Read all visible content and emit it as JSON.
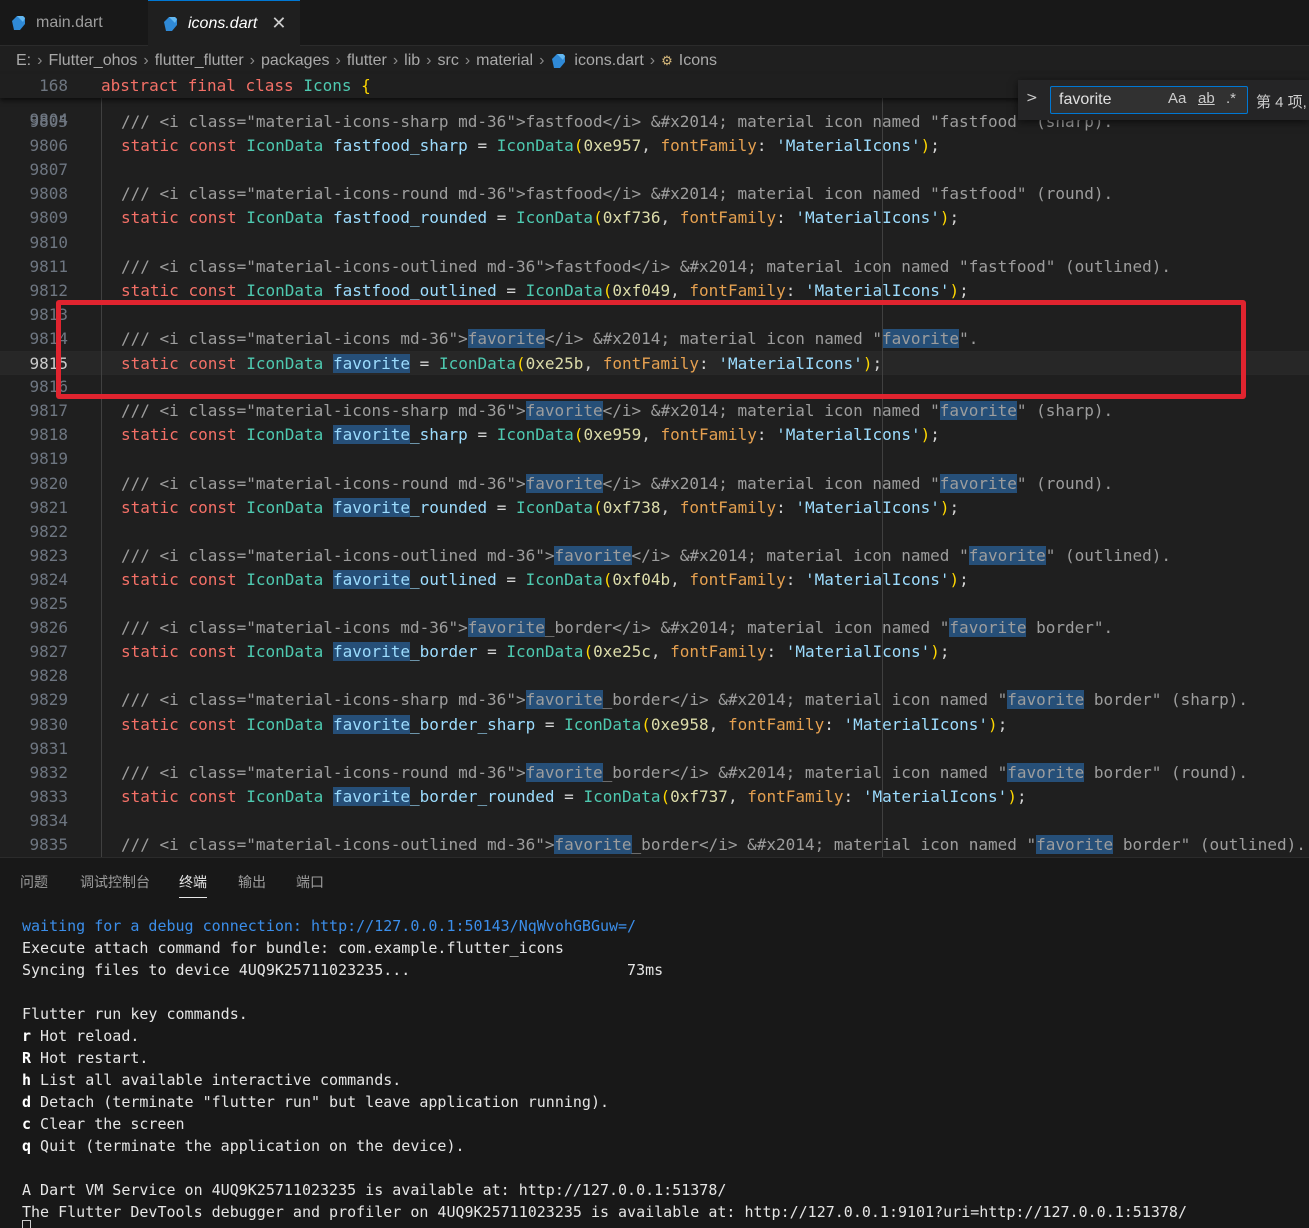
{
  "tabs": [
    {
      "label": "main.dart",
      "active": false
    },
    {
      "label": "icons.dart",
      "active": true,
      "close": "✕"
    }
  ],
  "breadcrumb": [
    "E:",
    "Flutter_ohos",
    "flutter_flutter",
    "packages",
    "flutter",
    "lib",
    "src",
    "material",
    "icons.dart",
    "Icons"
  ],
  "sticky": {
    "line": "168",
    "code": [
      "abstract final class Icons {"
    ]
  },
  "find": {
    "value": "favorite",
    "toggle": ">",
    "match_case": "Aa",
    "whole_word": "ab",
    "regex": ".*",
    "count": "第 4 项,"
  },
  "editor": {
    "partial_line_number": "9804",
    "current_line": "9815",
    "lines": [
      {
        "n": "9805",
        "text": "/// <i class=\"material-icons-sharp md-36\">fastfood</i> &#x2014; material icon named \"fastfood\" (sharp)."
      },
      {
        "n": "9806",
        "text": "static const IconData fastfood_sharp = IconData(0xe957, fontFamily: 'MaterialIcons');"
      },
      {
        "n": "9807",
        "text": ""
      },
      {
        "n": "9808",
        "text": "/// <i class=\"material-icons-round md-36\">fastfood</i> &#x2014; material icon named \"fastfood\" (round)."
      },
      {
        "n": "9809",
        "text": "static const IconData fastfood_rounded = IconData(0xf736, fontFamily: 'MaterialIcons');"
      },
      {
        "n": "9810",
        "text": ""
      },
      {
        "n": "9811",
        "text": "/// <i class=\"material-icons-outlined md-36\">fastfood</i> &#x2014; material icon named \"fastfood\" (outlined)."
      },
      {
        "n": "9812",
        "text": "static const IconData fastfood_outlined = IconData(0xf049, fontFamily: 'MaterialIcons');"
      },
      {
        "n": "9813",
        "text": ""
      },
      {
        "n": "9814",
        "text": "/// <i class=\"material-icons md-36\">favorite</i> &#x2014; material icon named \"favorite\"."
      },
      {
        "n": "9815",
        "text": "static const IconData favorite = IconData(0xe25b, fontFamily: 'MaterialIcons');"
      },
      {
        "n": "9816",
        "text": ""
      },
      {
        "n": "9817",
        "text": "/// <i class=\"material-icons-sharp md-36\">favorite</i> &#x2014; material icon named \"favorite\" (sharp)."
      },
      {
        "n": "9818",
        "text": "static const IconData favorite_sharp = IconData(0xe959, fontFamily: 'MaterialIcons');"
      },
      {
        "n": "9819",
        "text": ""
      },
      {
        "n": "9820",
        "text": "/// <i class=\"material-icons-round md-36\">favorite</i> &#x2014; material icon named \"favorite\" (round)."
      },
      {
        "n": "9821",
        "text": "static const IconData favorite_rounded = IconData(0xf738, fontFamily: 'MaterialIcons');"
      },
      {
        "n": "9822",
        "text": ""
      },
      {
        "n": "9823",
        "text": "/// <i class=\"material-icons-outlined md-36\">favorite</i> &#x2014; material icon named \"favorite\" (outlined)."
      },
      {
        "n": "9824",
        "text": "static const IconData favorite_outlined = IconData(0xf04b, fontFamily: 'MaterialIcons');"
      },
      {
        "n": "9825",
        "text": ""
      },
      {
        "n": "9826",
        "text": "/// <i class=\"material-icons md-36\">favorite_border</i> &#x2014; material icon named \"favorite border\"."
      },
      {
        "n": "9827",
        "text": "static const IconData favorite_border = IconData(0xe25c, fontFamily: 'MaterialIcons');"
      },
      {
        "n": "9828",
        "text": ""
      },
      {
        "n": "9829",
        "text": "/// <i class=\"material-icons-sharp md-36\">favorite_border</i> &#x2014; material icon named \"favorite border\" (sharp)."
      },
      {
        "n": "9830",
        "text": "static const IconData favorite_border_sharp = IconData(0xe958, fontFamily: 'MaterialIcons');"
      },
      {
        "n": "9831",
        "text": ""
      },
      {
        "n": "9832",
        "text": "/// <i class=\"material-icons-round md-36\">favorite_border</i> &#x2014; material icon named \"favorite border\" (round)."
      },
      {
        "n": "9833",
        "text": "static const IconData favorite_border_rounded = IconData(0xf737, fontFamily: 'MaterialIcons');"
      },
      {
        "n": "9834",
        "text": ""
      },
      {
        "n": "9835",
        "text": "/// <i class=\"material-icons-outlined md-36\">favorite_border</i> &#x2014; material icon named \"favorite border\" (outlined)."
      }
    ]
  },
  "panel": {
    "tabs": [
      {
        "label": "问题",
        "active": false
      },
      {
        "label": "调试控制台",
        "active": false
      },
      {
        "label": "终端",
        "active": true
      },
      {
        "label": "输出",
        "active": false
      },
      {
        "label": "端口",
        "active": false
      }
    ],
    "terminal": [
      {
        "text": "waiting for a debug connection: http://127.0.0.1:50143/NqWvohGBGuw=/",
        "style": "blue"
      },
      {
        "text": "Execute attach command for bundle: com.example.flutter_icons"
      },
      {
        "text": "Syncing files to device 4UQ9K25711023235...                        73ms"
      },
      {
        "text": ""
      },
      {
        "text": "Flutter run key commands."
      },
      {
        "key": "r",
        "text": " Hot reload."
      },
      {
        "key": "R",
        "text": " Hot restart."
      },
      {
        "key": "h",
        "text": " List all available interactive commands."
      },
      {
        "key": "d",
        "text": " Detach (terminate \"flutter run\" but leave application running)."
      },
      {
        "key": "c",
        "text": " Clear the screen"
      },
      {
        "key": "q",
        "text": " Quit (terminate the application on the device)."
      },
      {
        "text": ""
      },
      {
        "text": "A Dart VM Service on 4UQ9K25711023235 is available at: http://127.0.0.1:51378/"
      },
      {
        "text": "The Flutter DevTools debugger and profiler on 4UQ9K25711023235 is available at: http://127.0.0.1:9101?uri=http://127.0.0.1:51378/"
      }
    ]
  },
  "colors": {
    "annotation_box": "#e0242f",
    "find_highlight": "#264f78",
    "keyword": "#f47067",
    "type": "#4ec9b0",
    "string": "#9cdcfe"
  }
}
